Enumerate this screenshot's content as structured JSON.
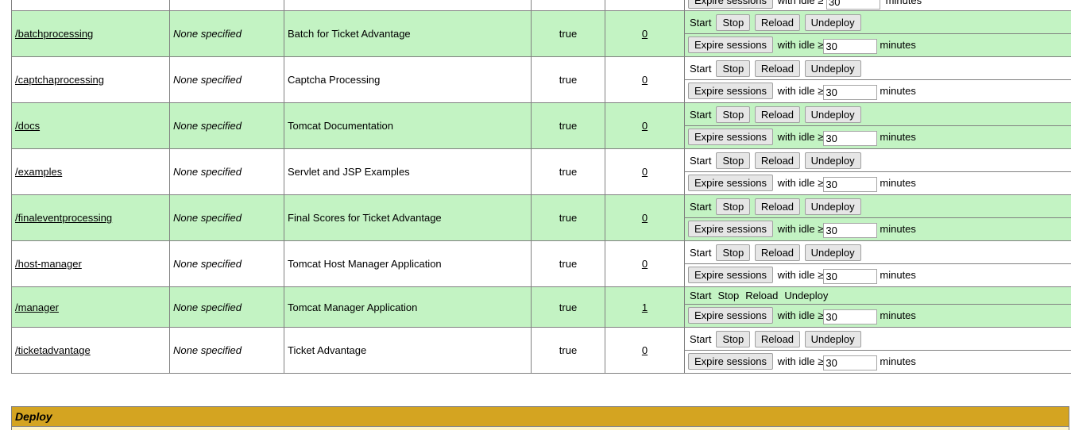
{
  "labels": {
    "start": "Start",
    "stop": "Stop",
    "reload": "Reload",
    "undeploy": "Undeploy",
    "expire": "Expire sessions",
    "with_idle": "with idle ≥",
    "minutes": "minutes"
  },
  "partial_row": {
    "idle": "30"
  },
  "apps": [
    {
      "path": "/batchprocessing",
      "version": "None specified",
      "display": "Batch for Ticket Advantage",
      "running": "true",
      "sessions": "0",
      "idle": "30",
      "buttons": true
    },
    {
      "path": "/captchaprocessing",
      "version": "None specified",
      "display": "Captcha Processing",
      "running": "true",
      "sessions": "0",
      "idle": "30",
      "buttons": true
    },
    {
      "path": "/docs",
      "version": "None specified",
      "display": "Tomcat Documentation",
      "running": "true",
      "sessions": "0",
      "idle": "30",
      "buttons": true
    },
    {
      "path": "/examples",
      "version": "None specified",
      "display": "Servlet and JSP Examples",
      "running": "true",
      "sessions": "0",
      "idle": "30",
      "buttons": true
    },
    {
      "path": "/finaleventprocessing",
      "version": "None specified",
      "display": "Final Scores for Ticket Advantage",
      "running": "true",
      "sessions": "0",
      "idle": "30",
      "buttons": true
    },
    {
      "path": "/host-manager",
      "version": "None specified",
      "display": "Tomcat Host Manager Application",
      "running": "true",
      "sessions": "0",
      "idle": "30",
      "buttons": true
    },
    {
      "path": "/manager",
      "version": "None specified",
      "display": "Tomcat Manager Application",
      "running": "true",
      "sessions": "1",
      "idle": "30",
      "buttons": false
    },
    {
      "path": "/ticketadvantage",
      "version": "None specified",
      "display": "Ticket Advantage",
      "running": "true",
      "sessions": "0",
      "idle": "30",
      "buttons": true
    }
  ],
  "deploy": {
    "title": "Deploy"
  },
  "colors": {
    "row_even": "#c3f3c3",
    "row_odd": "#ffffff",
    "deploy_header": "#d4a421"
  }
}
